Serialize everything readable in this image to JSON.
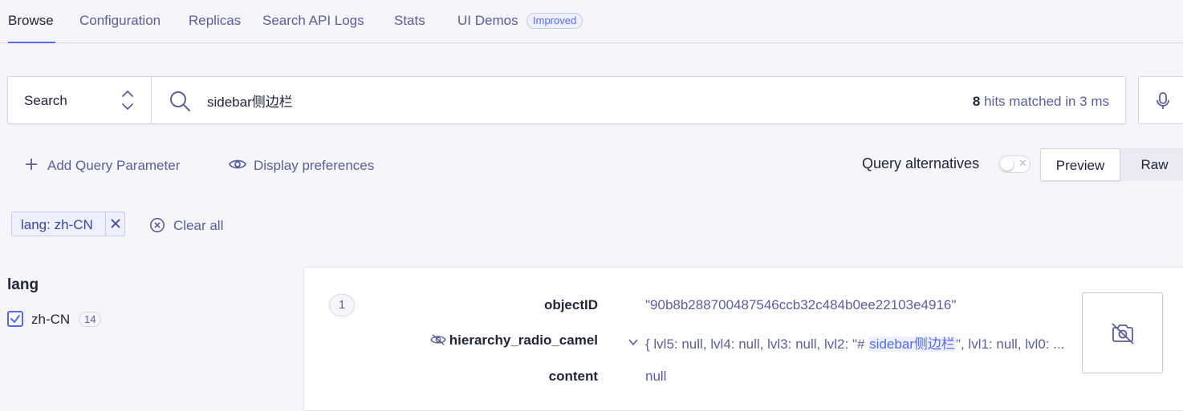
{
  "tabs": [
    {
      "label": "Browse",
      "active": true
    },
    {
      "label": "Configuration",
      "active": false
    },
    {
      "label": "Replicas",
      "active": false
    },
    {
      "label": "Search API Logs",
      "active": false
    },
    {
      "label": "Stats",
      "active": false
    },
    {
      "label": "UI Demos",
      "active": false,
      "badge": "Improved"
    }
  ],
  "search": {
    "mode": "Search",
    "query": "sidebar侧边栏",
    "hits_count": "8",
    "hits_text": " hits matched in 3 ms"
  },
  "actions": {
    "add_query_parameter": "Add Query Parameter",
    "display_preferences": "Display preferences"
  },
  "query_alternatives": {
    "label": "Query alternatives",
    "enabled": false
  },
  "view_toggle": {
    "preview": "Preview",
    "raw": "Raw",
    "selected": "Preview"
  },
  "filters": {
    "chips": [
      {
        "label": "lang: zh-CN"
      }
    ],
    "clear_all": "Clear all"
  },
  "facets": {
    "title": "lang",
    "items": [
      {
        "label": "zh-CN",
        "count": "14",
        "checked": true
      }
    ]
  },
  "hit": {
    "number": "1",
    "attributes": [
      {
        "name": "objectID",
        "value": "\"90b8b288700487546ccb32c484b0ee22103e4916\""
      },
      {
        "name": "hierarchy_radio_camel",
        "value_prefix": "{ lvl5: null, lvl4: null, lvl3: null, lvl2: \"# ",
        "value_highlight": "sidebar侧边栏",
        "value_suffix": "\", lvl1: null, lvl0: ...",
        "hidden": true,
        "expandable": true
      },
      {
        "name": "content",
        "value": "null"
      }
    ],
    "image_icon": "no-image-icon"
  },
  "colors": {
    "accent": "#5468ff",
    "text": "#23263b",
    "muted": "#5a5e9a",
    "background": "#f5f5fa",
    "border": "#d6d6e7"
  }
}
